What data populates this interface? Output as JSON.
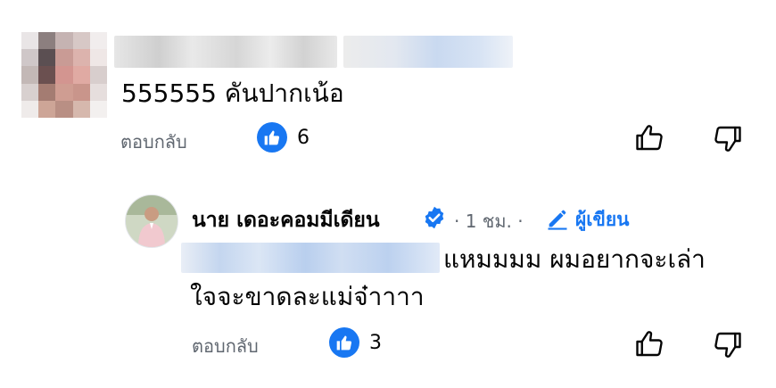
{
  "comment": {
    "text": "555555 คันปากเน้อ",
    "reply_label": "ตอบกลับ",
    "like_count": "6"
  },
  "reply": {
    "author": "นาย เดอะคอมมีเดียน",
    "time": "· 1 ชม. ·",
    "author_tag": "ผู้เขียน",
    "text_line1": "แหมมมม ผมอยากจะเล่า",
    "text_line2": "ใจจะขาดละแม่จ๋าาาา",
    "reply_label": "ตอบกลับ",
    "like_count": "3"
  },
  "colors": {
    "accent": "#1877f2",
    "muted_text": "#606770",
    "text": "#050505"
  },
  "icons": [
    "like-badge-icon",
    "thumbs-up-icon",
    "thumbs-down-icon",
    "verified-badge-icon",
    "pencil-icon"
  ]
}
